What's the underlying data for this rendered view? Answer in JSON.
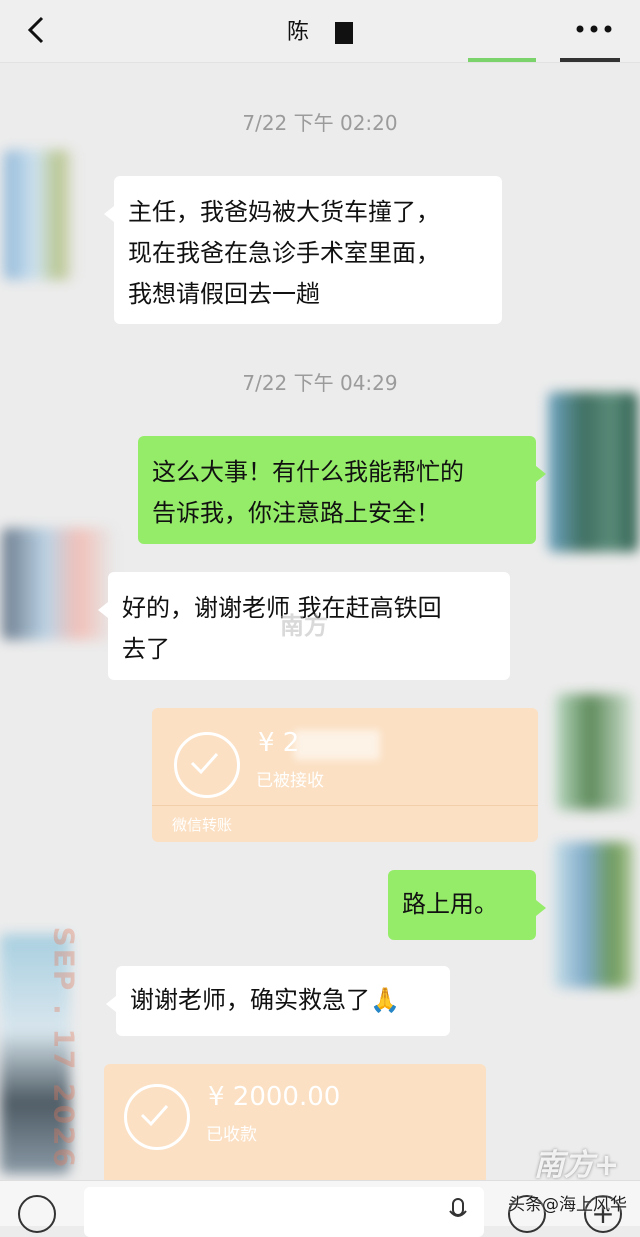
{
  "header": {
    "back_icon": "chevron-left-icon",
    "contact_name": "陈",
    "more_icon": "more-dots-icon"
  },
  "messages": {
    "ts1": "7/22 下午 02:20",
    "m1_l1": "主任，我爸妈被大货车撞了，",
    "m1_l2": "现在我爸在急诊手术室里面，",
    "m1_l3": "我想请假回去一趟",
    "ts2": "7/22 下午 04:29",
    "m2_l1": "这么大事！有什么我能帮忙的",
    "m2_l2": "告诉我，你注意路上安全！",
    "m3_l1": "好的，谢谢老师 我在赶高铁回",
    "m3_l2": "去了",
    "t1_amount": "¥ 2",
    "t1_status": "已被接收",
    "t1_footer": "微信转账",
    "m4": "路上用。",
    "m5": "谢谢老师，确实救急了🙏",
    "t2_amount": "¥ 2000.00",
    "t2_status": "已收款"
  },
  "watermarks": {
    "date_stamp": "SEP . 17 2026",
    "logo_center": "南方",
    "logo_corner": "南方+"
  },
  "footer": {
    "credit": "头条@海上风华"
  },
  "colors": {
    "bg": "#ececec",
    "outgoing": "#95ec69",
    "incoming": "#ffffff",
    "transfer": "#fbe0c3",
    "timestamp": "#9b9b9b"
  }
}
